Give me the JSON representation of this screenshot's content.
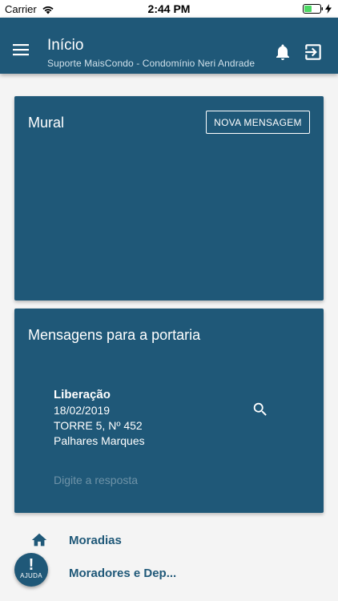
{
  "status_bar": {
    "carrier": "Carrier",
    "time": "2:44 PM"
  },
  "app_bar": {
    "title": "Início",
    "subtitle": "Suporte MaisCondo - Condomínio Neri Andrade"
  },
  "mural": {
    "title": "Mural",
    "new_message_button": "NOVA MENSAGEM"
  },
  "gate_messages": {
    "title": "Mensagens para a portaria",
    "item": {
      "type": "Liberação",
      "date": "18/02/2019",
      "unit": "TORRE 5, Nº 452",
      "name": "Palhares Marques"
    },
    "reply_placeholder": "Digite a resposta"
  },
  "nav": {
    "items": [
      {
        "label": "Moradias",
        "icon": "home-icon"
      },
      {
        "label": "Moradores e Dep...",
        "icon": "people-icon"
      }
    ]
  },
  "help": {
    "mark": "!",
    "label": "AJUDA"
  },
  "colors": {
    "primary": "#1f5878",
    "background": "#f4f4f4"
  }
}
